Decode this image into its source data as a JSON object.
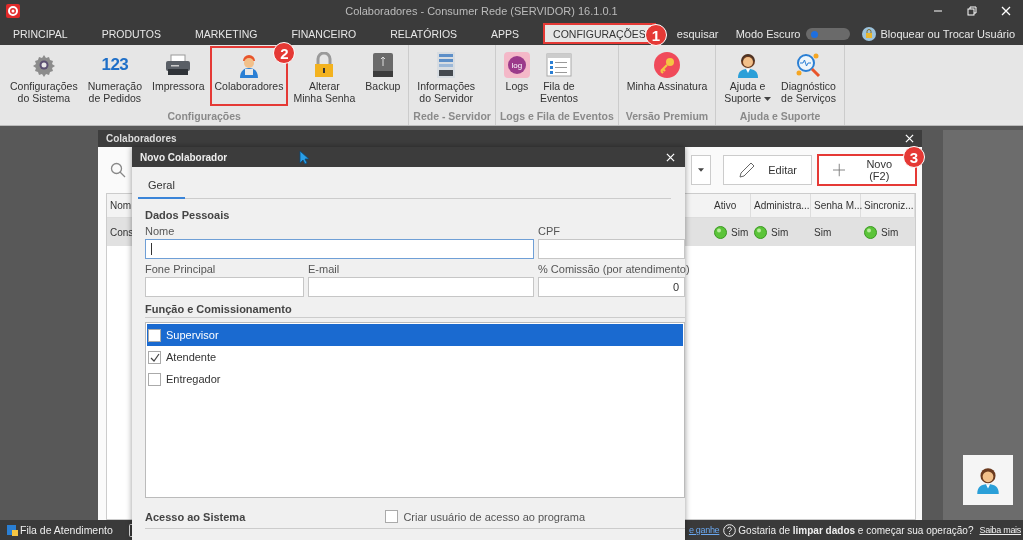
{
  "window": {
    "title": "Colaboradores - Consumer Rede (SERVIDOR) 16.1.0.1"
  },
  "menu": {
    "tabs": [
      {
        "label": "PRINCIPAL",
        "selected": false,
        "highlighted": false
      },
      {
        "label": "PRODUTOS",
        "selected": false,
        "highlighted": false
      },
      {
        "label": "MARKETING",
        "selected": false,
        "highlighted": false
      },
      {
        "label": "FINANCEIRO",
        "selected": false,
        "highlighted": false
      },
      {
        "label": "RELATÓRIOS",
        "selected": false,
        "highlighted": false
      },
      {
        "label": "APPS",
        "selected": false,
        "highlighted": false
      },
      {
        "label": "CONFIGURAÇÕES",
        "selected": true,
        "highlighted": true,
        "badge": "1"
      }
    ],
    "search": "esquisar",
    "dark_mode": {
      "label": "Modo Escuro",
      "on": false
    },
    "lock_user": "Bloquear ou Trocar Usuário"
  },
  "ribbon": {
    "groups": [
      {
        "label": "Configurações",
        "items": [
          {
            "label": "Configurações\ndo Sistema",
            "highlighted": false
          },
          {
            "label": "Numeração\nde Pedidos",
            "icon_text": "123",
            "highlighted": false
          },
          {
            "label": "Impressora",
            "highlighted": false
          },
          {
            "label": "Colaboradores",
            "highlighted": true,
            "badge": "2"
          },
          {
            "label": "Alterar\nMinha Senha",
            "highlighted": false
          },
          {
            "label": "Backup",
            "highlighted": false
          }
        ]
      },
      {
        "label": "Rede - Servidor",
        "items": [
          {
            "label": "Informações\ndo Servidor",
            "highlighted": false
          }
        ]
      },
      {
        "label": "Logs e Fila de Eventos",
        "items": [
          {
            "label": "Logs",
            "icon_text": "log",
            "highlighted": false
          },
          {
            "label": "Fila de\nEventos",
            "highlighted": false
          }
        ]
      },
      {
        "label": "Versão Premium",
        "items": [
          {
            "label": "Minha Assinatura",
            "highlighted": false
          }
        ]
      },
      {
        "label": "Ajuda e Suporte",
        "items": [
          {
            "label": "Ajuda e\nSuporte",
            "dropdown": true,
            "highlighted": false
          },
          {
            "label": "Diagnóstico\nde Serviços",
            "highlighted": false
          }
        ]
      }
    ]
  },
  "list_window": {
    "title": "Colaboradores",
    "edit_button": "Editar",
    "new_button": {
      "label": "Novo (F2)",
      "highlighted": true,
      "badge": "3"
    },
    "table": {
      "columns": [
        "Nom",
        "Ativo",
        "Administra...",
        "Senha M...",
        "Sincroniz..."
      ],
      "rows": [
        {
          "selected": true,
          "cells": [
            {
              "kind": "text",
              "text": "Cons"
            },
            {
              "kind": "status",
              "text": "Sim"
            },
            {
              "kind": "status",
              "text": "Sim"
            },
            {
              "kind": "text",
              "text": "Sim"
            },
            {
              "kind": "status",
              "text": "Sim"
            }
          ]
        }
      ]
    }
  },
  "dialog": {
    "title": "Novo Colaborador",
    "tabs": [
      {
        "label": "Geral",
        "selected": true
      }
    ],
    "personal": {
      "heading": "Dados Pessoais",
      "fields": [
        {
          "label": "Nome",
          "focused": true
        },
        {
          "label": "CPF",
          "focused": false
        },
        {
          "label": "Fone Principal",
          "focused": false
        },
        {
          "label": "E-mail",
          "focused": false
        },
        {
          "label": "% Comissão (por atendimento)",
          "value": "0",
          "focused": false
        }
      ]
    },
    "roles": {
      "heading": "Função e Comissionamento",
      "items": [
        {
          "label": "Supervisor",
          "checked": false,
          "selected": true
        },
        {
          "label": "Atendente",
          "checked": true,
          "selected": false
        },
        {
          "label": "Entregador",
          "checked": false,
          "selected": false
        }
      ]
    },
    "access": {
      "heading": "Acesso ao Sistema",
      "option": {
        "label": "Criar usuário de acesso ao programa",
        "checked": false
      }
    }
  },
  "status_bar": {
    "queue": "Fila de Atendimento",
    "promo_link": "e ganhe",
    "question": "Gostaria de **limpar dados** e começar sua operação?",
    "learn_more": "Saiba mais"
  }
}
